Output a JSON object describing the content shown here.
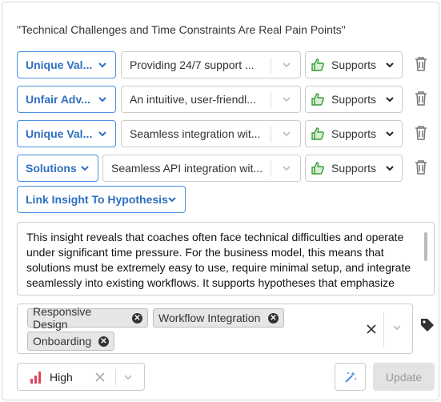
{
  "title": "\"Technical Challenges and Time Constraints Are Real Pain Points\"",
  "links": [
    {
      "category": "Unique Val...",
      "statement": "Providing 24/7 support ...",
      "relation": "Supports"
    },
    {
      "category": "Unfair Adv...",
      "statement": "An intuitive, user-friendl...",
      "relation": "Supports"
    },
    {
      "category": "Unique Val...",
      "statement": "Seamless integration wit...",
      "relation": "Supports"
    },
    {
      "category": "Solutions",
      "statement": "Seamless API integration wit...",
      "relation": "Supports"
    }
  ],
  "link_button_label": "Link Insight To Hypothesis",
  "description": "This insight reveals that coaches often face technical difficulties and operate under significant time pressure. For the business model, this means that solutions must be extremely easy to use, require minimal setup, and integrate seamlessly into existing workflows. It supports hypotheses that emphasize",
  "tags": [
    "Responsive Design",
    "Workflow Integration",
    "Onboarding"
  ],
  "priority": {
    "label": "High",
    "color": "#e0445a"
  },
  "update_label": "Update",
  "colors": {
    "accent": "#4a90e2",
    "thumb_green": "#3a9a3a"
  }
}
